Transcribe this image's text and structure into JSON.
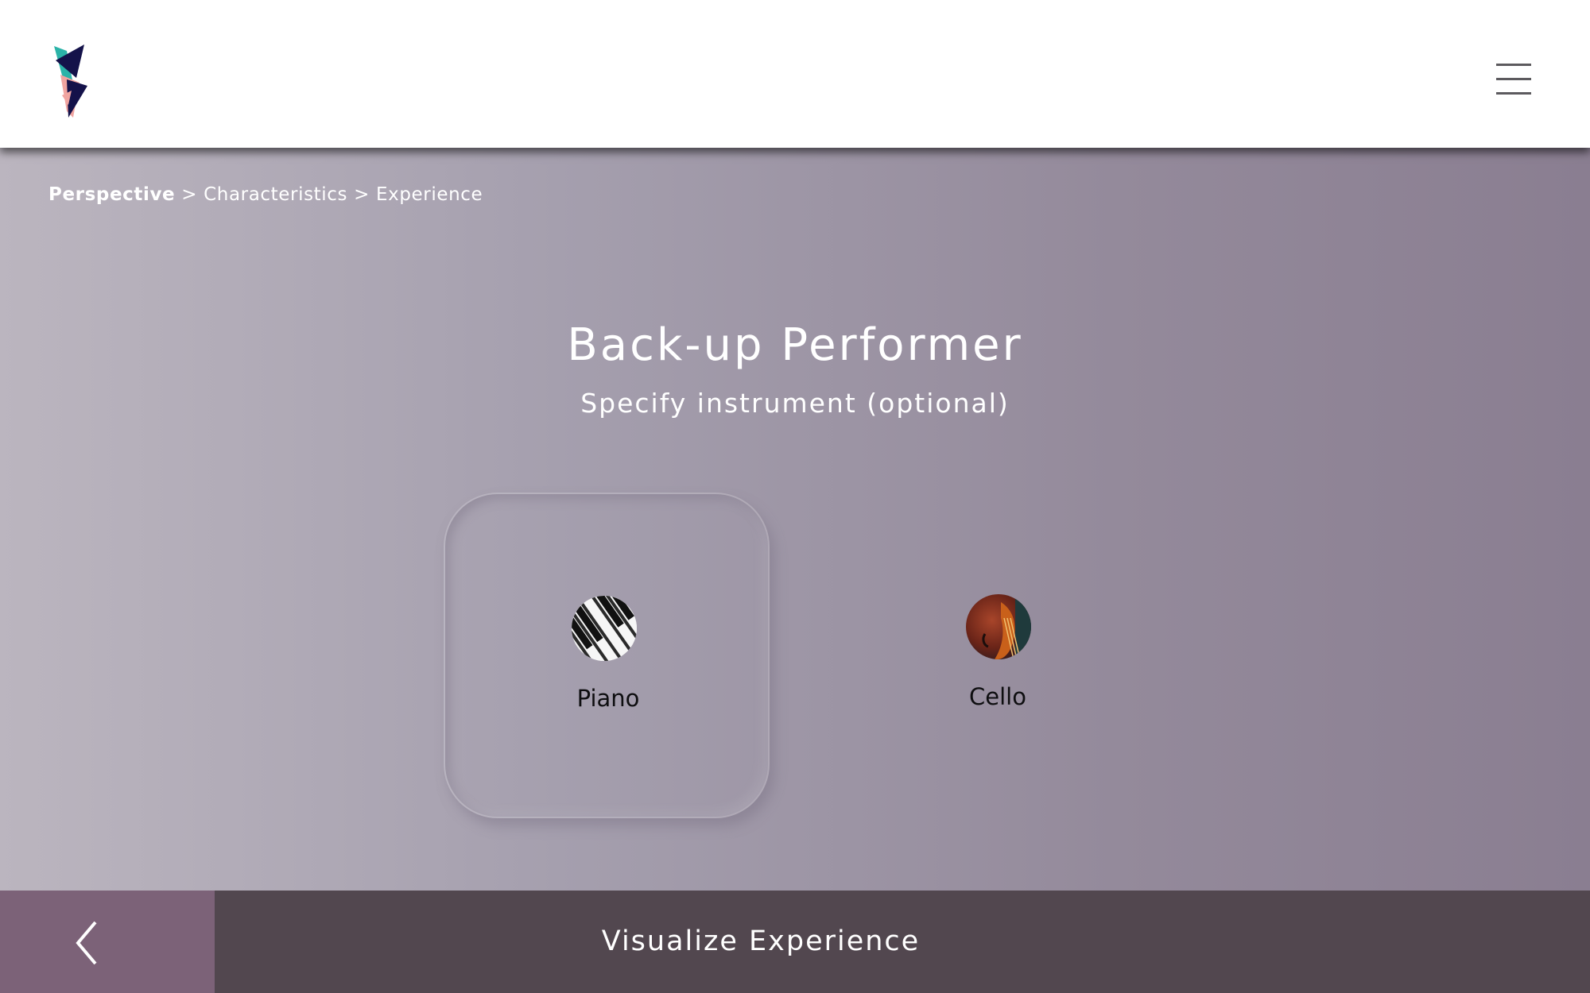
{
  "header": {
    "logo_icon": "brand-logo-icon",
    "menu_icon": "hamburger-menu-icon"
  },
  "breadcrumb": {
    "items": [
      "Perspective",
      "Characteristics",
      "Experience"
    ],
    "separator": ">"
  },
  "main": {
    "title": "Back-up Performer",
    "subtitle": "Specify instrument (optional)",
    "options": [
      {
        "label": "Piano",
        "icon": "piano-keys-icon",
        "selected": true
      },
      {
        "label": "Cello",
        "icon": "cello-icon",
        "selected": false
      }
    ]
  },
  "footer": {
    "back_icon": "chevron-left-icon",
    "action_label": "Visualize Experience"
  },
  "colors": {
    "header_bg": "#ffffff",
    "footer_bg": "#52474f",
    "back_button_bg": "#7c6278",
    "gradient_start": "#bbb5bf",
    "gradient_end": "#8a7e91"
  }
}
